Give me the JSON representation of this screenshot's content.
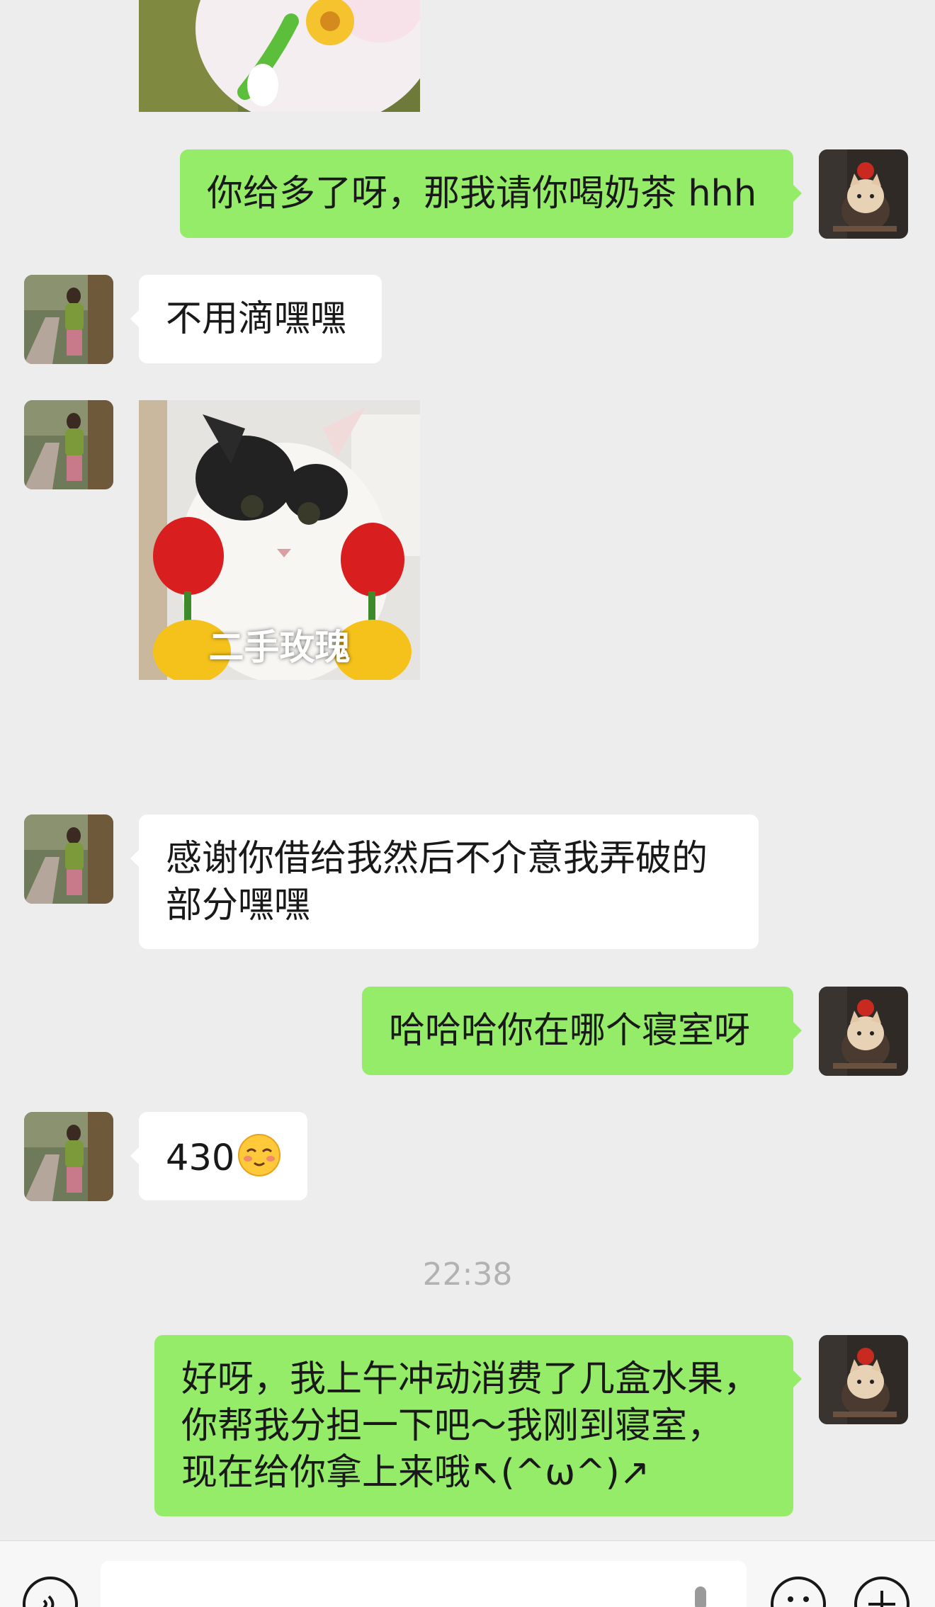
{
  "messages": {
    "m1": {
      "side": "right",
      "text": "你给多了呀，那我请你喝奶茶 hhh"
    },
    "m2": {
      "side": "left",
      "text": "不用滴嘿嘿"
    },
    "m3": {
      "side": "left",
      "type": "sticker",
      "caption": "二手玫瑰"
    },
    "m4": {
      "side": "left",
      "line1": "感谢你借给我然后不介意我弄破的",
      "line2": "部分嘿嘿"
    },
    "m5": {
      "side": "right",
      "text": "哈哈哈你在哪个寝室呀"
    },
    "m6": {
      "side": "left",
      "text": "430"
    },
    "m7": {
      "side": "right",
      "line1": "好呀，我上午冲动消费了几盒水果，",
      "line2": "你帮我分担一下吧～我刚到寝室，",
      "line3": "现在给你拿上来哦↖(^ω^)↗"
    }
  },
  "timestamp": "22:38",
  "colors": {
    "background": "#EDEDED",
    "sent_bubble": "#95EC69",
    "received_bubble": "#FFFFFF",
    "timestamp_text": "#B2B2B2"
  },
  "icons": {
    "voice": "voice-input-icon",
    "microphone": "microphone-icon",
    "emoji": "emoji-icon",
    "more": "plus-icon"
  }
}
